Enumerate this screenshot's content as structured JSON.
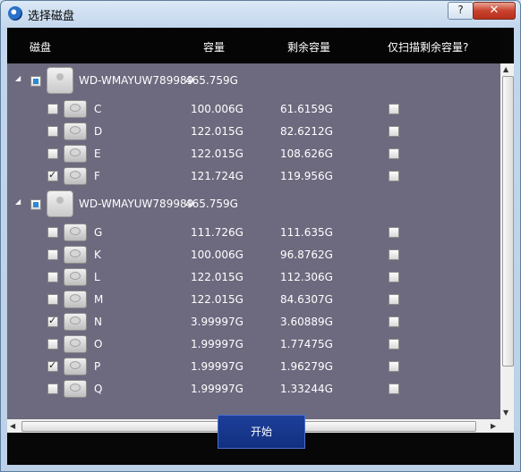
{
  "window": {
    "title": "选择磁盘",
    "help_label": "?",
    "close_label": "✕"
  },
  "header": {
    "disk": "磁盘",
    "capacity": "容量",
    "free": "剩余容量",
    "scan_free_only": "仅扫描剩余容量?"
  },
  "disks": [
    {
      "name": "WD-WMAYUW789989",
      "capacity": "465.759G",
      "partitions": [
        {
          "letter": "C",
          "capacity": "100.006G",
          "free": "61.6159G",
          "checked": false
        },
        {
          "letter": "D",
          "capacity": "122.015G",
          "free": "82.6212G",
          "checked": false
        },
        {
          "letter": "E",
          "capacity": "122.015G",
          "free": "108.626G",
          "checked": false
        },
        {
          "letter": "F",
          "capacity": "121.724G",
          "free": "119.956G",
          "checked": true
        }
      ]
    },
    {
      "name": "WD-WMAYUW789989",
      "capacity": "465.759G",
      "partitions": [
        {
          "letter": "G",
          "capacity": "111.726G",
          "free": "111.635G",
          "checked": false
        },
        {
          "letter": "K",
          "capacity": "100.006G",
          "free": "96.8762G",
          "checked": false
        },
        {
          "letter": "L",
          "capacity": "122.015G",
          "free": "112.306G",
          "checked": false
        },
        {
          "letter": "M",
          "capacity": "122.015G",
          "free": "84.6307G",
          "checked": false
        },
        {
          "letter": "N",
          "capacity": "3.99997G",
          "free": "3.60889G",
          "checked": true
        },
        {
          "letter": "O",
          "capacity": "1.99997G",
          "free": "1.77475G",
          "checked": false
        },
        {
          "letter": "P",
          "capacity": "1.99997G",
          "free": "1.96279G",
          "checked": true
        },
        {
          "letter": "Q",
          "capacity": "1.99997G",
          "free": "1.33244G",
          "checked": false
        }
      ]
    }
  ],
  "footer": {
    "start_label": "开始"
  }
}
